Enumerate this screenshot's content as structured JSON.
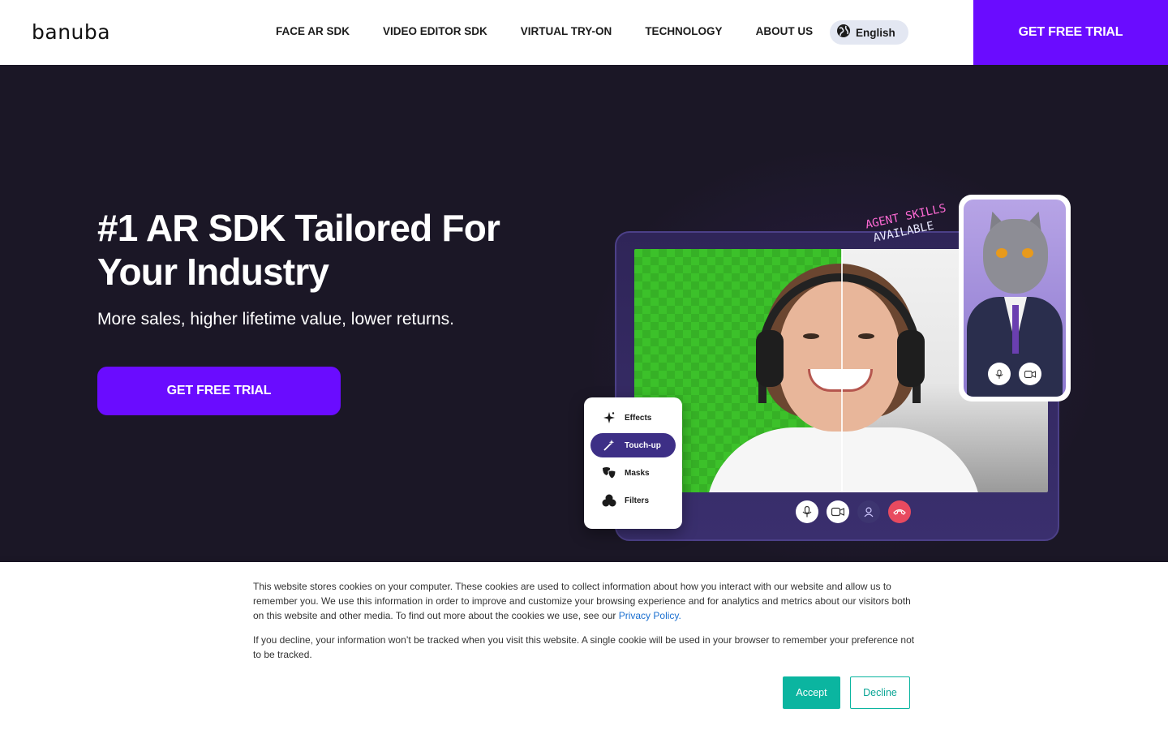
{
  "header": {
    "logo": "banuba",
    "nav": [
      "FACE AR SDK",
      "VIDEO EDITOR SDK",
      "VIRTUAL TRY-ON",
      "TECHNOLOGY",
      "ABOUT US"
    ],
    "language": {
      "label": "English",
      "icon": "globe-icon"
    },
    "trial_button": "GET FREE TRIAL"
  },
  "hero": {
    "title": "#1 AR SDK Tailored For Your Industry",
    "subtitle": "More sales, higher lifetime value, lower returns.",
    "trial_button": "GET FREE TRIAL",
    "badge_line1": "AGENT SKILLS",
    "badge_line2": "AVAILABLE",
    "effects_menu": [
      {
        "label": "Effects",
        "icon": "sparkle-icon",
        "active": false
      },
      {
        "label": "Touch-up",
        "icon": "magic-wand-icon",
        "active": true
      },
      {
        "label": "Masks",
        "icon": "theater-masks-icon",
        "active": false
      },
      {
        "label": "Filters",
        "icon": "filters-circles-icon",
        "active": false
      }
    ],
    "call_controls": [
      "microphone-icon",
      "video-camera-icon",
      "add-person-icon",
      "hang-up-icon"
    ],
    "accent_purple": "#6a0cff"
  },
  "cookie_banner": {
    "paragraph1_before_link": "This website stores cookies on your computer. These cookies are used to collect information about how you interact with our website and allow us to remember you. We use this information in order to improve and customize your browsing experience and for analytics and metrics about our visitors both on this website and other media. To find out more about the cookies we use, see our ",
    "privacy_link": "Privacy Policy.",
    "paragraph2": "If you decline, your information won’t be tracked when you visit this website. A single cookie will be used in your browser to remember your preference not to be tracked.",
    "accept": "Accept",
    "decline": "Decline",
    "accent_teal": "#0bb5a0"
  }
}
